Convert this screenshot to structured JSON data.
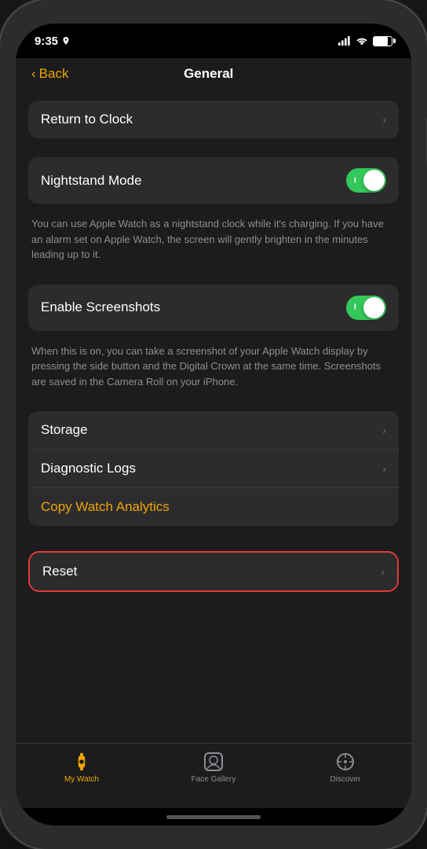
{
  "status_bar": {
    "time": "9:35",
    "signal": "●●●●",
    "wifi": "WiFi",
    "battery": "Battery"
  },
  "nav": {
    "back_label": "Back",
    "title": "General"
  },
  "items": {
    "return_to_clock": "Return to Clock",
    "nightstand_mode": "Nightstand Mode",
    "nightstand_description": "You can use Apple Watch as a nightstand clock while it's charging. If you have an alarm set on Apple Watch, the screen will gently brighten in the minutes leading up to it.",
    "enable_screenshots": "Enable Screenshots",
    "screenshots_description": "When this is on, you can take a screenshot of your Apple Watch display by pressing the side button and the Digital Crown at the same time. Screenshots are saved in the Camera Roll on your iPhone.",
    "storage": "Storage",
    "diagnostic_logs": "Diagnostic Logs",
    "copy_watch_analytics": "Copy Watch Analytics",
    "reset": "Reset"
  },
  "tab_bar": {
    "my_watch": "My Watch",
    "face_gallery": "Face Gallery",
    "discover": "Discover"
  }
}
